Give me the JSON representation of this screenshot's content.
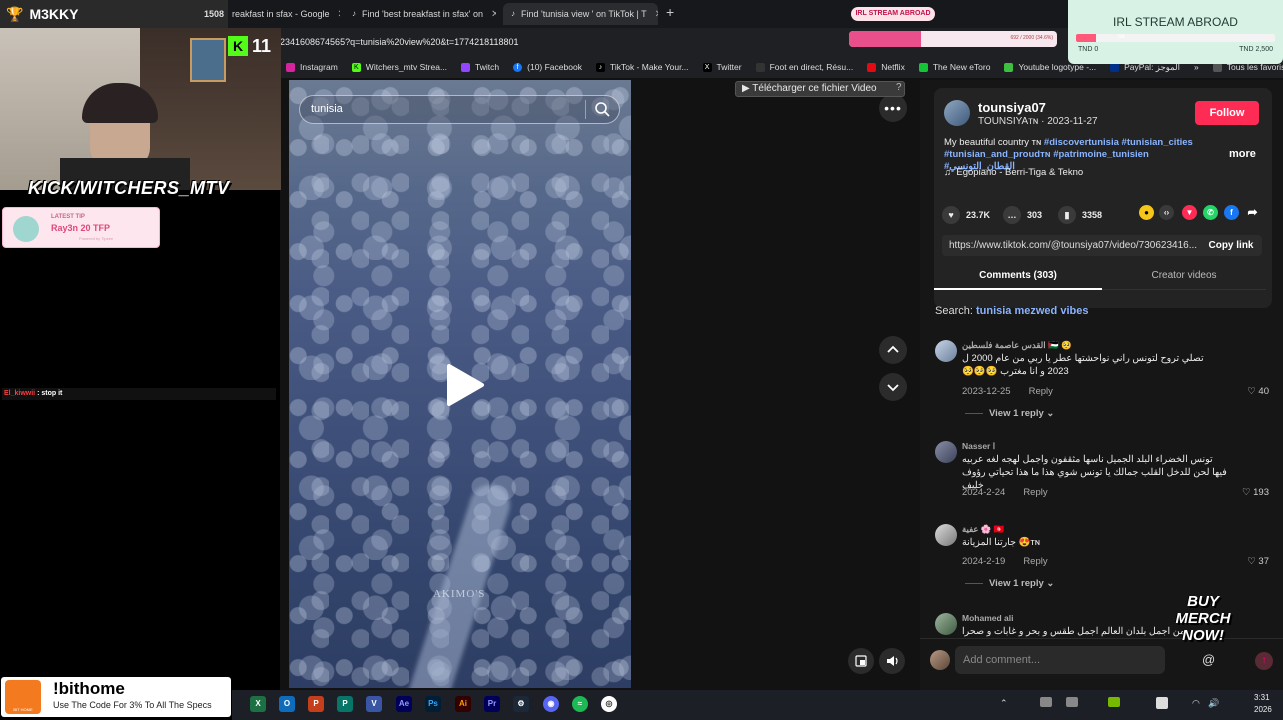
{
  "browser": {
    "tabs": [
      {
        "label": "reakfast in sfax - Google",
        "close": "✕"
      },
      {
        "label": "Find 'best breakfast in sfax' on",
        "close": "✕"
      },
      {
        "label": "Find 'tunisia view ' on TikTok | T",
        "close": "✕"
      }
    ],
    "new_tab": "+",
    "address": "23416086745​65?q=tunisia%20view%20&t=1774218118801",
    "bookmarks": [
      "Instagram",
      "Witchers_mtv Strea...",
      "Twitch",
      "(10) Facebook",
      "TikTok - Make Your...",
      "Twitter",
      "Foot en direct, Résu...",
      "Netflix",
      "The New eToro",
      "Youtube logotype -...",
      "PayPal: الموجز",
      "Tous les favoris"
    ],
    "bookmark_chevron": "»"
  },
  "tiktok": {
    "search_value": "tunisia",
    "watermark": "AKIMO'S",
    "download_label": "▶ Télécharger ce fichier Video",
    "download_help": "?",
    "creator": {
      "username": "tounsiya07",
      "nickname": "TOUNSIYAᴛɴ",
      "date": "2023-11-27",
      "follow": "Follow"
    },
    "description_plain": "My beautiful country ᴛɴ ",
    "tags": [
      "#discovertunisia",
      "#tunisian_cities",
      "#tunisian_and_proudᴛɴ",
      "#patrimoine_tunisien",
      "#القطان_التونسي"
    ],
    "more": "more",
    "music": "Egopiano - Berri-Tiga & Tekno",
    "stats": {
      "likes": "23.7K",
      "comments": "303",
      "saves": "3358"
    },
    "share_url": "https://www.tiktok.com/@tounsiya07/video/73062341​6...",
    "copy_link": "Copy link",
    "tab_comments": "Comments (303)",
    "tab_creator": "Creator videos",
    "search_prefix": "Search: ",
    "search_term": "tunisia mezwed vibes",
    "comments": [
      {
        "name": "القدس عاصمة فلسطين 🇵🇸 🥺",
        "text": "تصلي تروح لتونس راني نواحشتها عطر يا ربي من عام 2000 ل 2023 و انا مغترب 🥺🥺🥺",
        "date": "2023-12-25",
        "reply": "Reply",
        "likes": "40",
        "view": "View 1 reply ⌄"
      },
      {
        "name": "Nasser ا",
        "text": "تونس الخضراء البلد الجميل ناسها مثقفون واجمل لهجه لغه عربيه فيها لحن للدخل القلب جمالك يا تونس شوي هذا ما هذا تحياتي رؤوف خليف",
        "date": "2024-2-24",
        "reply": "Reply",
        "likes": "193"
      },
      {
        "name": "عفية 🌸 🇹🇳",
        "text": "ᴛɴ😍 جارتنا المزيانة",
        "date": "2024-2-19",
        "reply": "Reply",
        "likes": "37",
        "view": "View 1 reply ⌄"
      },
      {
        "name": "Mohamed ali",
        "text": "من اجمل بلدان العالم اجمل طقس و بحر و غابات و صحرا"
      }
    ],
    "comment_placeholder": "Add comment...",
    "mention": "@"
  },
  "stream": {
    "channel": "M3KKY",
    "channel_count": "1508",
    "kick_count": "11",
    "kick_handle": "KICK/WITCHERS_MTV",
    "tip_title": "LATEST TIP",
    "tip_text": "Ray3n 20 TFP",
    "tip_sub": "Powered by Tipeee",
    "chat_user": "El_kiwwii",
    "chat_text": " : stop it",
    "irl_pill": "IRL STREAM ABROAD",
    "irl_title": "IRL STREAM ABROAD",
    "irl_left": "TND 0",
    "irl_right": "TND 2,500",
    "irl_tag": "NA",
    "irl_top_text": "692 / 2000 (34.6%)",
    "merch": "BUY MERCH NOW!",
    "bithome_title": "!bithome",
    "bithome_sub": "Use The Code For 3% To All The Specs",
    "bithome_logo": "BIT HOME",
    "clock_time": "3:31",
    "clock_date": "2026"
  },
  "colors": {
    "follow": "#fe2c55",
    "tag": "#8ab4ff",
    "kick": "#53fc18",
    "panel": "#161616"
  },
  "progress": {
    "irl_top": 0.346,
    "irl_box": 0.1
  }
}
